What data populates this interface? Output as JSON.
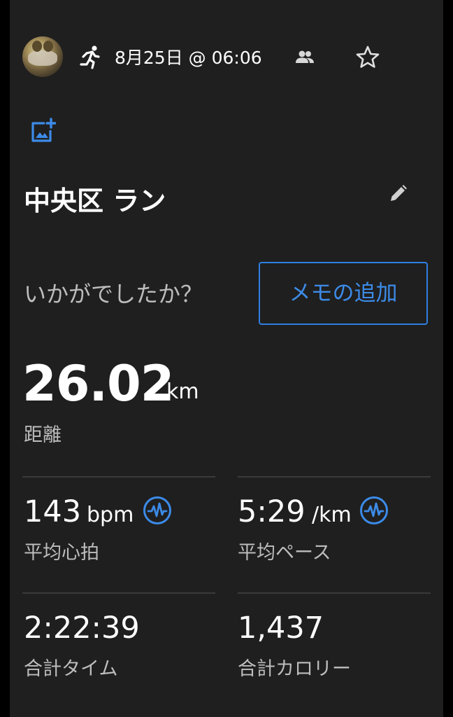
{
  "header": {
    "date": "8月25日 @ 06:06",
    "icons": {
      "activity": "running-icon",
      "audience": "people-icon",
      "favorite": "star-icon"
    }
  },
  "photo": {
    "add_icon": "add-photo-icon"
  },
  "activity": {
    "title": "中央区 ラン",
    "edit_icon": "pencil-icon"
  },
  "feedback": {
    "question": "いかがでしたか？",
    "memo_button": "メモの追加"
  },
  "distance": {
    "value": "26.02",
    "unit": "km",
    "label": "距離"
  },
  "stats": [
    {
      "value": "143",
      "unit": "bpm",
      "label": "平均心拍",
      "icon": "pulse-icon"
    },
    {
      "value": "5:29",
      "unit": "/km",
      "label": "平均ペース",
      "icon": "pulse-icon"
    },
    {
      "value": "2:22:39",
      "unit": "",
      "label": "合計タイム"
    },
    {
      "value": "1,437",
      "unit": "",
      "label": "合計カロリー"
    }
  ],
  "colors": {
    "background": "#1f1f1f",
    "accent": "#3c8be8",
    "text": "#ffffff",
    "secondary_text": "#bdbdbd",
    "divider": "#3a3a3a"
  }
}
